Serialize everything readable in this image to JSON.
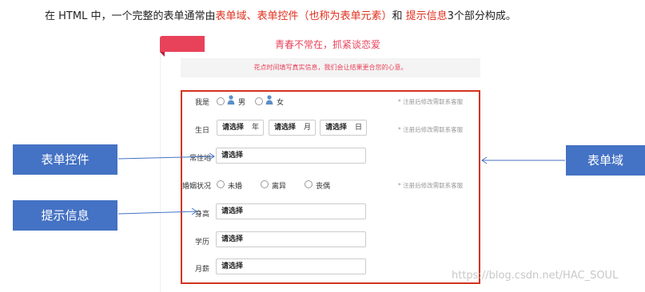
{
  "intro": {
    "part1": "在 HTML 中，一个完整的表单通常由",
    "term_form_field": "表单域",
    "sep1": "、",
    "term_form_controls": "表单控件（也称为表单元素）",
    "part2": "和 ",
    "term_hint_info": "提示信息",
    "part3": "3个部分构成。"
  },
  "form": {
    "title": "青春不常在，抓紧谈恋爱",
    "hint_bar": "花点时间填写真实信息，我们会让结果更合您的心意。",
    "rows": {
      "gender": {
        "label": "我是",
        "male": "男",
        "female": "女",
        "tip": "* 注册后修改需联系客服"
      },
      "birthday": {
        "label": "生日",
        "year_value": "请选择",
        "year_unit": "年",
        "month_value": "请选择",
        "month_unit": "月",
        "day_value": "请选择",
        "day_unit": "日",
        "tip": "* 注册后修改需联系客服"
      },
      "residence": {
        "label": "常住地",
        "value": "请选择"
      },
      "marital": {
        "label": "婚姻状况",
        "options": [
          "未婚",
          "离异",
          "丧偶"
        ],
        "tip": "* 注册后修改需联系客服"
      },
      "height": {
        "label": "身高",
        "value": "请选择"
      },
      "education": {
        "label": "学历",
        "value": "请选择"
      },
      "salary": {
        "label": "月薪",
        "value": "请选择"
      }
    }
  },
  "callouts": {
    "form_controls": "表单控件",
    "hint_info": "提示信息",
    "form_field": "表单域"
  },
  "watermark": "https://blog.csdn.net/HAC_SOUL",
  "colors": {
    "highlight": "#e0301e",
    "callout_bg": "#4472c4",
    "form_box_border": "#d2341f",
    "accent_pink": "#e8425a"
  }
}
